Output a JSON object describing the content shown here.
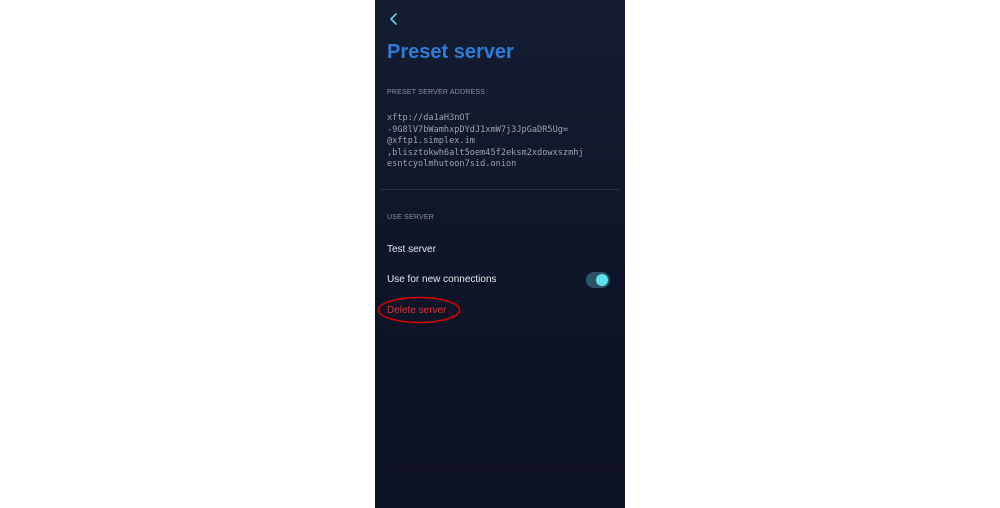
{
  "header": {
    "back_icon": "chevron-left-icon",
    "title": "Preset server"
  },
  "preset_section": {
    "label": "PRESET SERVER ADDRESS",
    "address_lines": [
      "xftp://da1aH3nOT",
      "-9G8lV7bWamhxpDYdJ1xmW7j3JpGaDR5Ug=",
      "@xftp1.simplex.im",
      ",blisztokwh6alt5oem45f2eksm2xdowxszmhj",
      "esntcyolmhutoon7sid.onion"
    ]
  },
  "use_section": {
    "label": "USE SERVER",
    "test_label": "Test server",
    "new_connections_label": "Use for new connections",
    "new_connections_enabled": true,
    "delete_label": "Delete server"
  },
  "colors": {
    "title": "#2f7bd8",
    "toggle_track": "#2c5467",
    "toggle_knob": "#5fe0ea",
    "delete": "#e03232",
    "highlight_ellipse": "#e00000"
  }
}
